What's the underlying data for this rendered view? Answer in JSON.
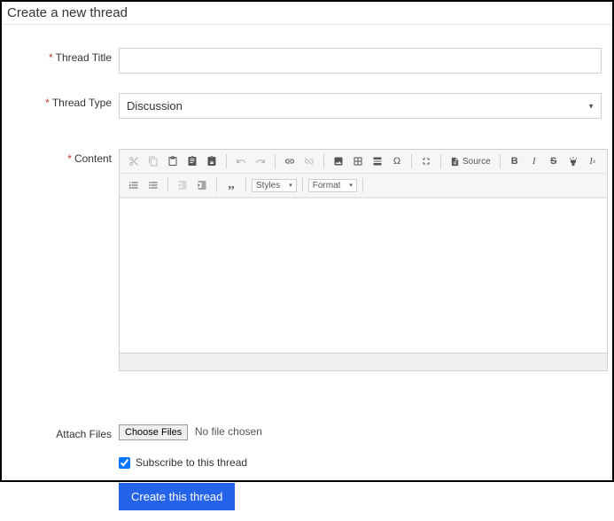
{
  "page": {
    "title": "Create a new thread"
  },
  "labels": {
    "thread_title": "Thread Title",
    "thread_type": "Thread Type",
    "content": "Content",
    "attach_files": "Attach Files"
  },
  "thread_type": {
    "value": "Discussion"
  },
  "editor_toolbar": {
    "source_label": "Source",
    "styles_label": "Styles",
    "format_label": "Format"
  },
  "file": {
    "button_label": "Choose Files",
    "status": "No file chosen"
  },
  "subscribe": {
    "label": "Subscribe to this thread",
    "checked": true
  },
  "submit": {
    "label": "Create this thread"
  }
}
